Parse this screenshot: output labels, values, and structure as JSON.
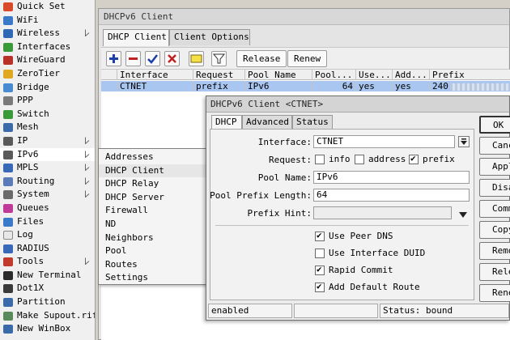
{
  "sidebar": {
    "items": [
      {
        "label": "Quick Set",
        "icon": "quick-set-icon",
        "color": "#d94a2a",
        "submenu": false
      },
      {
        "label": "WiFi",
        "icon": "wifi-icon",
        "color": "#3a78c8",
        "submenu": false
      },
      {
        "label": "Wireless",
        "icon": "wireless-icon",
        "color": "#2f68b4",
        "submenu": true
      },
      {
        "label": "Interfaces",
        "icon": "interfaces-icon",
        "color": "#3a9a3a",
        "submenu": false
      },
      {
        "label": "WireGuard",
        "icon": "wireguard-icon",
        "color": "#b8322a",
        "submenu": false
      },
      {
        "label": "ZeroTier",
        "icon": "zerotier-icon",
        "color": "#e0a820",
        "submenu": false
      },
      {
        "label": "Bridge",
        "icon": "bridge-icon",
        "color": "#4a8ad0",
        "submenu": false
      },
      {
        "label": "PPP",
        "icon": "ppp-icon",
        "color": "#7a7a7a",
        "submenu": false
      },
      {
        "label": "Switch",
        "icon": "switch-icon",
        "color": "#3a9a3a",
        "submenu": false
      },
      {
        "label": "Mesh",
        "icon": "mesh-icon",
        "color": "#3a6aa8",
        "submenu": false
      },
      {
        "label": "IP",
        "icon": "ip-icon",
        "color": "#5a5a5a",
        "submenu": true
      },
      {
        "label": "IPv6",
        "icon": "ipv6-icon",
        "color": "#5a5a5a",
        "submenu": true,
        "selected": true
      },
      {
        "label": "MPLS",
        "icon": "mpls-icon",
        "color": "#3a68b8",
        "submenu": true
      },
      {
        "label": "Routing",
        "icon": "routing-icon",
        "color": "#5a7ab8",
        "submenu": true
      },
      {
        "label": "System",
        "icon": "system-icon",
        "color": "#6a6a6a",
        "submenu": true
      },
      {
        "label": "Queues",
        "icon": "queues-icon",
        "color": "#c03a9a",
        "submenu": false
      },
      {
        "label": "Files",
        "icon": "files-icon",
        "color": "#3a7ac8",
        "submenu": false
      },
      {
        "label": "Log",
        "icon": "log-icon",
        "color": "#e8e8e8",
        "submenu": false
      },
      {
        "label": "RADIUS",
        "icon": "radius-icon",
        "color": "#3a68b8",
        "submenu": false
      },
      {
        "label": "Tools",
        "icon": "tools-icon",
        "color": "#c0392b",
        "submenu": true
      },
      {
        "label": "New Terminal",
        "icon": "terminal-icon",
        "color": "#2a2a2a",
        "submenu": false
      },
      {
        "label": "Dot1X",
        "icon": "dot1x-icon",
        "color": "#3a3a3a",
        "submenu": false
      },
      {
        "label": "Partition",
        "icon": "partition-icon",
        "color": "#3a6aa8",
        "submenu": false
      },
      {
        "label": "Make Supout.rif",
        "icon": "supout-icon",
        "color": "#5a8a5a",
        "submenu": false
      },
      {
        "label": "New WinBox",
        "icon": "winbox-icon",
        "color": "#3a6aa8",
        "submenu": false
      }
    ]
  },
  "submenu": {
    "items": [
      "Addresses",
      "DHCP Client",
      "DHCP Relay",
      "DHCP Server",
      "Firewall",
      "ND",
      "Neighbors",
      "Pool",
      "Routes",
      "Settings"
    ],
    "selected_index": 1
  },
  "main_window": {
    "title": "DHCPv6 Client",
    "tabs": [
      "DHCP Client",
      "Client Options"
    ],
    "active_tab": 0,
    "toolbar": {
      "release_label": "Release",
      "renew_label": "Renew"
    },
    "columns": [
      "Interface",
      "Request",
      "Pool Name",
      "Pool...",
      "Use...",
      "Add...",
      "Prefix"
    ],
    "rows": [
      [
        "CTNET",
        "prefix",
        "IPv6",
        "64",
        "yes",
        "yes",
        "240"
      ]
    ]
  },
  "dialog": {
    "title": "DHCPv6 Client <CTNET>",
    "tabs": [
      "DHCP",
      "Advanced",
      "Status"
    ],
    "active_tab": 0,
    "fields": {
      "interface_label": "Interface:",
      "interface_value": "CTNET",
      "request_label": "Request:",
      "request_info": "info",
      "request_address": "address",
      "request_prefix": "prefix",
      "pool_name_label": "Pool Name:",
      "pool_name_value": "IPv6",
      "pool_prefix_length_label": "Pool Prefix Length:",
      "pool_prefix_length_value": "64",
      "prefix_hint_label": "Prefix Hint:",
      "prefix_hint_value": ""
    },
    "checkboxes": [
      {
        "label": "Use Peer DNS",
        "checked": true
      },
      {
        "label": "Use Interface DUID",
        "checked": false
      },
      {
        "label": "Rapid Commit",
        "checked": true
      },
      {
        "label": "Add Default Route",
        "checked": true
      }
    ],
    "request_checked": {
      "info": false,
      "address": false,
      "prefix": true
    },
    "status_bar": {
      "state": "enabled",
      "middle": "",
      "status": "Status: bound"
    },
    "buttons": [
      "OK",
      "Cancel",
      "Apply",
      "Disable",
      "Comment",
      "Copy",
      "Remove",
      "Release",
      "Renew"
    ]
  }
}
